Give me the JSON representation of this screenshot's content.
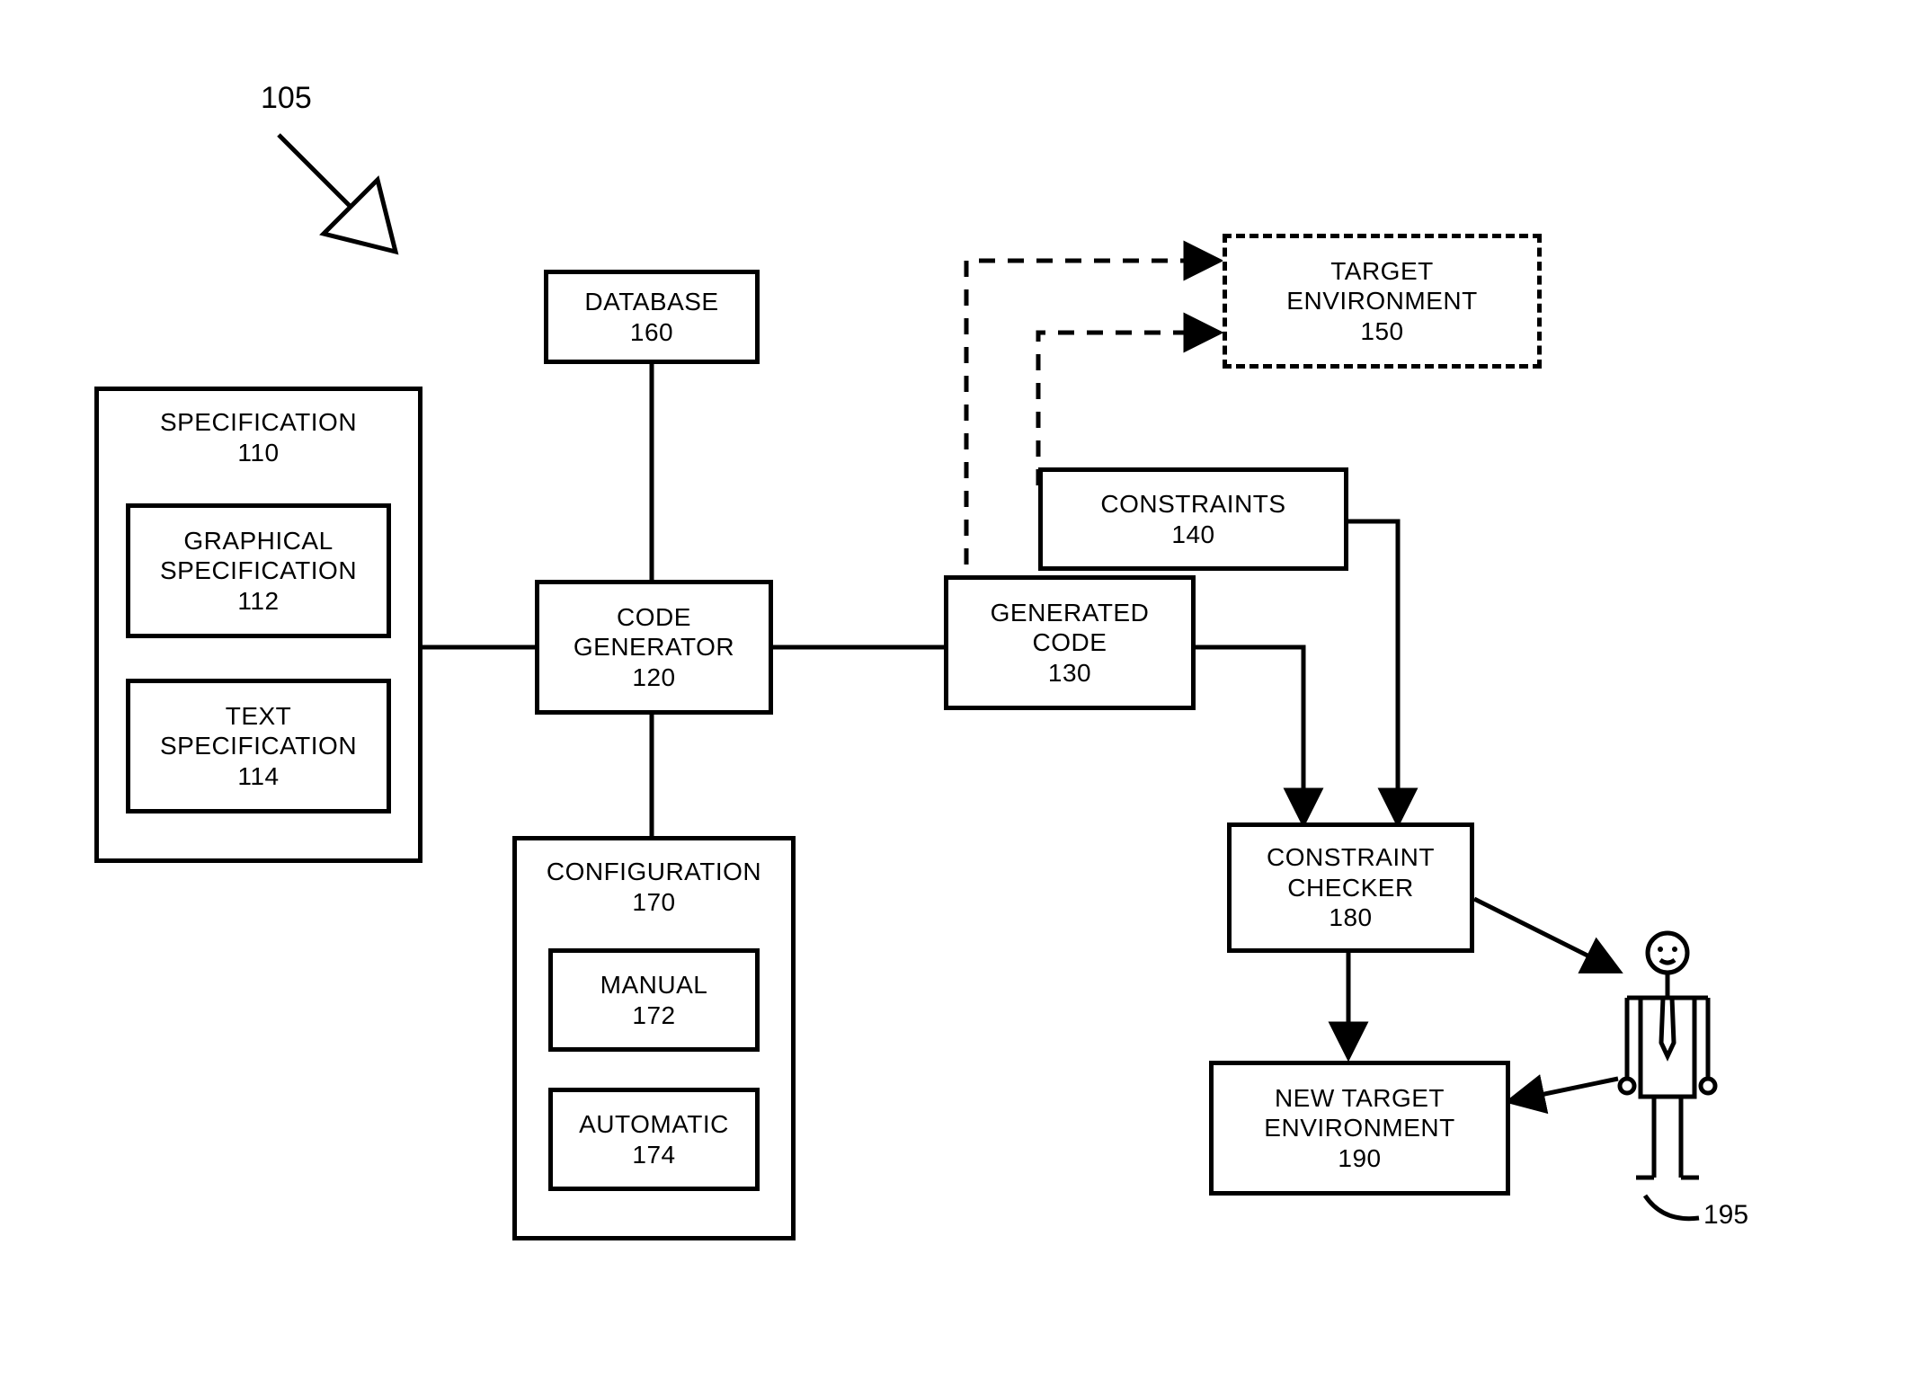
{
  "figure_ref": "105",
  "boxes": {
    "specification": {
      "title": "SPECIFICATION",
      "num": "110"
    },
    "graphical_spec": {
      "title": "GRAPHICAL\nSPECIFICATION",
      "num": "112"
    },
    "text_spec": {
      "title": "TEXT\nSPECIFICATION",
      "num": "114"
    },
    "database": {
      "title": "DATABASE",
      "num": "160"
    },
    "code_generator": {
      "title": "CODE\nGENERATOR",
      "num": "120"
    },
    "configuration": {
      "title": "CONFIGURATION",
      "num": "170"
    },
    "manual": {
      "title": "MANUAL",
      "num": "172"
    },
    "automatic": {
      "title": "AUTOMATIC",
      "num": "174"
    },
    "constraints": {
      "title": "CONSTRAINTS",
      "num": "140"
    },
    "generated_code": {
      "title": "GENERATED\nCODE",
      "num": "130"
    },
    "target_env": {
      "title": "TARGET\nENVIRONMENT",
      "num": "150"
    },
    "constraint_checker": {
      "title": "CONSTRAINT\nCHECKER",
      "num": "180"
    },
    "new_target_env": {
      "title": "NEW TARGET\nENVIRONMENT",
      "num": "190"
    },
    "user": {
      "num": "195"
    }
  }
}
